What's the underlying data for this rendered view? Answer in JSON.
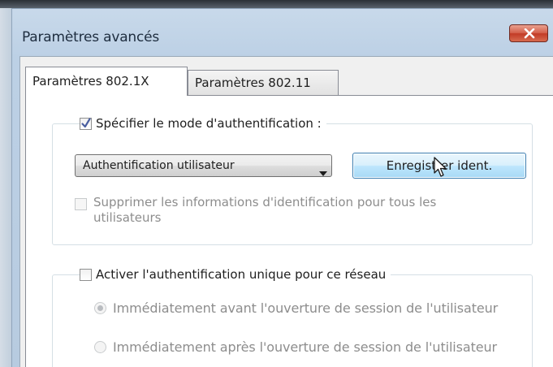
{
  "window": {
    "title": "Paramètres avancés"
  },
  "tabs": [
    {
      "label": "Paramètres 802.1X",
      "active": true
    },
    {
      "label": "Paramètres 802.11",
      "active": false
    }
  ],
  "auth_section": {
    "specify_mode_label": "Spécifier le mode d'authentification :",
    "specify_mode_checked": true,
    "mode_value": "Authentification utilisateur",
    "save_credentials_button": "Enregistrer ident.",
    "delete_credentials_label": "Supprimer les informations d'identification pour tous les utilisateurs",
    "delete_credentials_checked": false
  },
  "sso_section": {
    "enable_sso_label": "Activer l'authentification unique pour ce réseau",
    "enable_sso_checked": false,
    "radio_options": [
      {
        "label": "Immédiatement avant l'ouverture de session de l'utilisateur",
        "selected": true
      },
      {
        "label": "Immédiatement après l'ouverture de session de l'utilisateur",
        "selected": false
      }
    ]
  },
  "colors": {
    "window_frame": "#bcd0e5",
    "button_border": "#3c7fb1",
    "close_red": "#c23b26",
    "disabled_text": "#8d8d8d"
  }
}
